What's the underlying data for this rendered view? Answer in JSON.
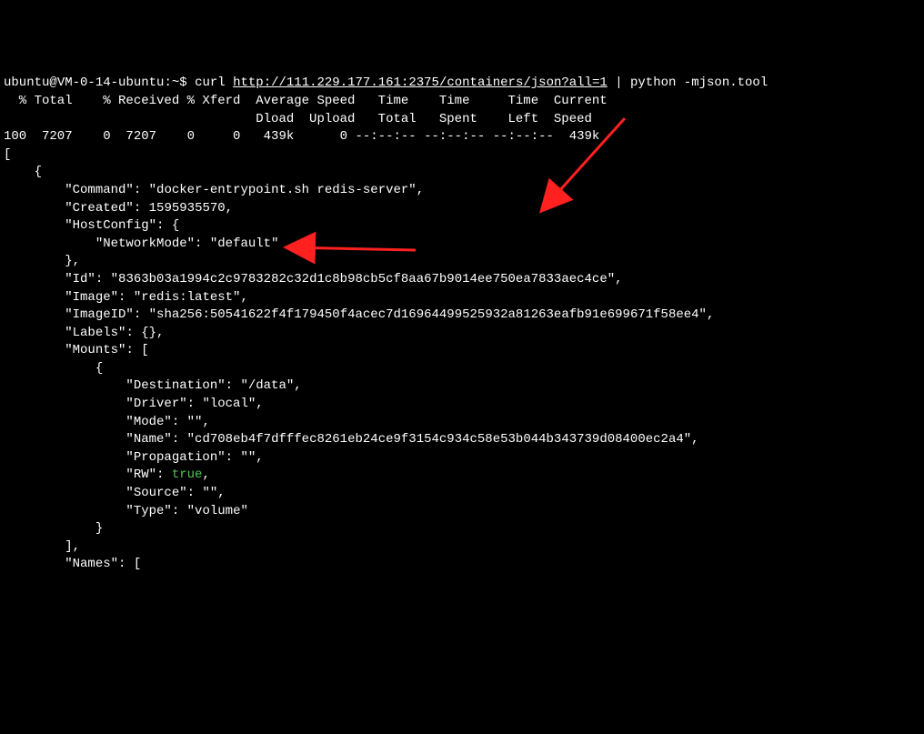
{
  "prompt": {
    "user": "ubuntu",
    "host": "VM-0-14-ubuntu",
    "path": "~",
    "symbol": "$"
  },
  "command": {
    "curl": "curl",
    "url_prefix": "http://111.229.177.161",
    "url_suffix": ":2375/containers/json?all=1",
    "pipe": "|",
    "python": "python -mjson.tool"
  },
  "headers": {
    "line1": "  % Total    % Received % Xferd  Average Speed   Time    Time     Time  Current",
    "line2": "                                 Dload  Upload   Total   Spent    Left  Speed",
    "line3": "100  7207    0  7207    0     0   439k      0 --:--:-- --:--:-- --:--:--  439k"
  },
  "json": {
    "open_bracket": "[",
    "open_brace": "    {",
    "command_key": "\"Command\"",
    "command_val": "\"docker-entrypoint.sh redis-server\"",
    "created_key": "\"Created\"",
    "created_val": "1595935570",
    "hostconfig_key": "\"HostConfig\"",
    "networkmode_key": "\"NetworkMode\"",
    "networkmode_val": "\"default\"",
    "id_key": "\"Id\"",
    "id_val": "\"8363b03a1994c2c9783282c32d1c8b98cb5cf8aa67b9014ee750ea7833aec4ce\"",
    "image_key": "\"Image\"",
    "image_val": "\"redis:latest\"",
    "imageid_key": "\"ImageID\"",
    "imageid_val": "\"sha256:50541622f4f179450f4acec7d16964499525932a81263eafb91e699671f58ee4\"",
    "labels_key": "\"Labels\"",
    "mounts_key": "\"Mounts\"",
    "destination_key": "\"Destination\"",
    "destination_val": "\"/data\"",
    "driver_key": "\"Driver\"",
    "driver_val": "\"local\"",
    "mode_key": "\"Mode\"",
    "mode_val": "\"\"",
    "name_key": "\"Name\"",
    "name_val": "\"cd708eb4f7dfffec8261eb24ce9f3154c934c58e53b044b343739d08400ec2a4\"",
    "propagation_key": "\"Propagation\"",
    "propagation_val": "\"\"",
    "rw_key": "\"RW\"",
    "rw_val": "true",
    "source_key": "\"Source\"",
    "source_val": "\"\"",
    "type_key": "\"Type\"",
    "type_val": "\"volume\"",
    "names_key": "\"Names\""
  }
}
